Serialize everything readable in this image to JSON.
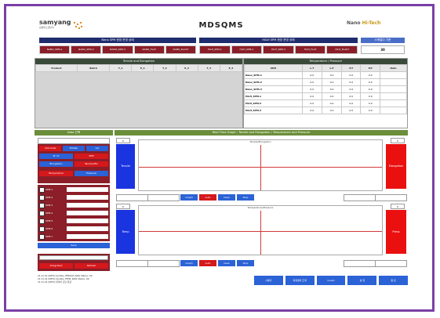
{
  "app": {
    "brand": "samyang",
    "brand_sub": "삼양이노켐(주)",
    "title": "MDSQMS",
    "partner_logo_a": "Nano",
    "partner_logo_b": "Hi-Tech"
  },
  "top": {
    "left_header": "Nano SPM 현장 운영 상태",
    "right_header": "Hi&H SPM 현장 운영 상태",
    "right_small_header": "스케일다 기준",
    "right_small_value": "30",
    "left_buttons": [
      "NANO_SPM-1",
      "NANO_SPM-2",
      "NANO_SPM-3",
      "NANO_FLAT",
      "NANO_ELAST"
    ],
    "right_buttons": [
      "HiLH_SPM-1",
      "HiLH_SPM-2",
      "HiLH_SPM-3",
      "HiLH_FLAT",
      "HiLH_ELAST"
    ]
  },
  "tension_table": {
    "header": "Tensile and Elongation",
    "columns": [
      "Product",
      "Batch",
      "T_1",
      "E_1",
      "T_2",
      "E_2",
      "T_3",
      "E_3"
    ]
  },
  "temp_table": {
    "header": "Temperature / Pressure",
    "columns": [
      "SPM",
      "L.T",
      "L.P",
      "P.T",
      "P.P",
      "Date"
    ],
    "rows": [
      [
        "Nano_SPM-1",
        "0.0",
        "0.0",
        "0.0",
        "0.0",
        ""
      ],
      [
        "Nano_SPM-2",
        "0.0",
        "0.0",
        "0.0",
        "0.0",
        ""
      ],
      [
        "Nano_SPM-3",
        "0.0",
        "0.0",
        "0.0",
        "0.0",
        ""
      ],
      [
        "HiLH_SPM-1",
        "0.0",
        "0.0",
        "0.0",
        "0.0",
        ""
      ],
      [
        "HiLH_SPM-2",
        "0.0",
        "0.0",
        "0.0",
        "0.0",
        ""
      ],
      [
        "HiLH_SPM-3",
        "0.0",
        "0.0",
        "0.0",
        "0.0",
        ""
      ]
    ]
  },
  "left_panel": {
    "header": "Data 선택",
    "btn_a": "Individual",
    "btn_b": "Hidden",
    "btn_c": "Lot",
    "btn_d": "M / D",
    "btn_e": "SPM",
    "btn_f": "Elongation",
    "btn_g": "Tension/Elo",
    "btn_h": "Temperature",
    "btn_i": "Pressure",
    "checks": [
      "SPM-1",
      "SPM-2",
      "SPM-3",
      "SPM-4",
      "SPM-5",
      "SPM-6",
      "SPM-7"
    ],
    "save": "Save",
    "btn_j": "Integrated",
    "btn_k": "Refresh"
  },
  "chart_area": {
    "header": "Real Time Graph : Tensile and Elongation / Temperature and Pressure",
    "chart1_title": "Tensile/Elongation",
    "chart2_title": "Temperature/Pressure",
    "left_label_1": "Tensile",
    "right_label_1": "Elongation",
    "left_label_2": "Temp",
    "right_label_2": "Press",
    "spin": "0",
    "ctrl_buttons": [
      "Graph",
      "Auto",
      "Clear",
      "Stop"
    ]
  },
  "log": {
    "lines": [
      "21:11:41 [INFO] Update_TENSILE_RAW Status: OK",
      "21:11:41 [INFO] Update_TEMP_RAW Status: OK",
      "21:11:41 [INFO] 데이터 로딩 완료"
    ]
  },
  "bottom_buttons": [
    "사용자",
    "측정결과 조회",
    "Graph",
    "설 정",
    "종 료"
  ]
}
